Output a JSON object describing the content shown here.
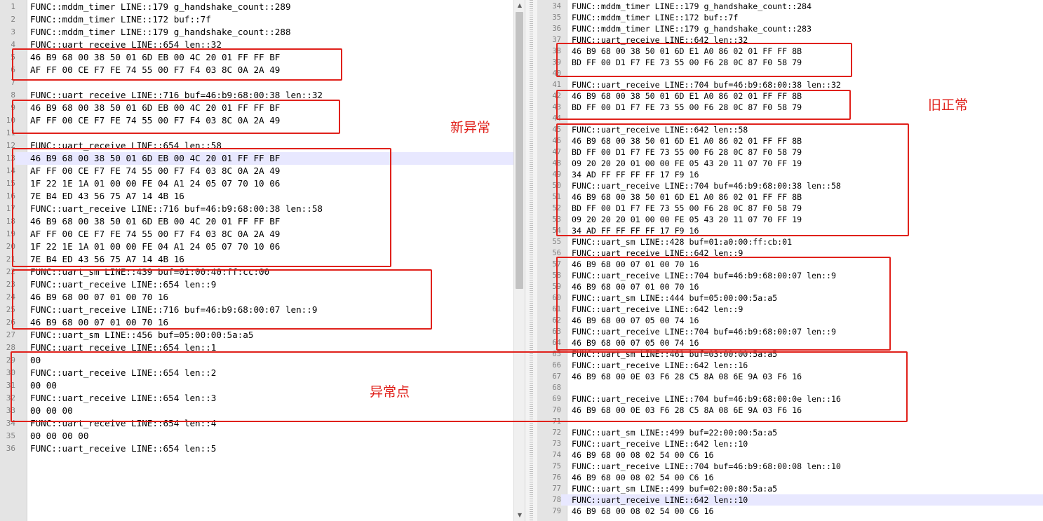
{
  "left_pane": {
    "lines": [
      {
        "n": "1",
        "text": "FUNC::mddm_timer LINE::179 g_handshake_count::289"
      },
      {
        "n": "2",
        "text": "FUNC::mddm_timer LINE::172 buf::7f"
      },
      {
        "n": "3",
        "text": "FUNC::mddm_timer LINE::179 g_handshake_count::288"
      },
      {
        "n": "4",
        "text": "FUNC::uart_receive LINE::654 len::32"
      },
      {
        "n": "5",
        "text": "46 B9 68 00 38 50 01 6D EB 00 4C 20 01 FF FF BF"
      },
      {
        "n": "6",
        "text": "AF FF 00 CE F7 FE 74 55 00 F7 F4 03 8C 0A 2A 49"
      },
      {
        "n": "7",
        "text": ""
      },
      {
        "n": "8",
        "text": "FUNC::uart_receive LINE::716 buf=46:b9:68:00:38 len::32"
      },
      {
        "n": "9",
        "text": "46 B9 68 00 38 50 01 6D EB 00 4C 20 01 FF FF BF"
      },
      {
        "n": "10",
        "text": "AF FF 00 CE F7 FE 74 55 00 F7 F4 03 8C 0A 2A 49"
      },
      {
        "n": "11",
        "text": ""
      },
      {
        "n": "12",
        "text": "FUNC::uart_receive LINE::654 len::58"
      },
      {
        "n": "13",
        "text": "46 B9 68 00 38 50 01 6D EB 00 4C 20 01 FF FF BF"
      },
      {
        "n": "14",
        "text": "AF FF 00 CE F7 FE 74 55 00 F7 F4 03 8C 0A 2A 49"
      },
      {
        "n": "15",
        "text": "1F 22 1E 1A 01 00 00 FE 04 A1 24 05 07 70 10 06"
      },
      {
        "n": "16",
        "text": "7E B4 ED 43 56 75 A7 14 4B 16"
      },
      {
        "n": "17",
        "text": "FUNC::uart_receive LINE::716 buf=46:b9:68:00:38 len::58"
      },
      {
        "n": "18",
        "text": "46 B9 68 00 38 50 01 6D EB 00 4C 20 01 FF FF BF"
      },
      {
        "n": "19",
        "text": "AF FF 00 CE F7 FE 74 55 00 F7 F4 03 8C 0A 2A 49"
      },
      {
        "n": "20",
        "text": "1F 22 1E 1A 01 00 00 FE 04 A1 24 05 07 70 10 06"
      },
      {
        "n": "21",
        "text": "7E B4 ED 43 56 75 A7 14 4B 16"
      },
      {
        "n": "22",
        "text": "FUNC::uart_sm LINE::439 buf=01:00:40:ff:cc:00"
      },
      {
        "n": "23",
        "text": "FUNC::uart_receive LINE::654 len::9"
      },
      {
        "n": "24",
        "text": "46 B9 68 00 07 01 00 70 16"
      },
      {
        "n": "25",
        "text": "FUNC::uart_receive LINE::716 buf=46:b9:68:00:07 len::9"
      },
      {
        "n": "26",
        "text": "46 B9 68 00 07 01 00 70 16"
      },
      {
        "n": "27",
        "text": "FUNC::uart_sm LINE::456 buf=05:00:00:5a:a5"
      },
      {
        "n": "28",
        "text": "FUNC::uart_receive LINE::654 len::1"
      },
      {
        "n": "29",
        "text": "00"
      },
      {
        "n": "30",
        "text": "FUNC::uart_receive LINE::654 len::2"
      },
      {
        "n": "31",
        "text": "00 00"
      },
      {
        "n": "32",
        "text": "FUNC::uart_receive LINE::654 len::3"
      },
      {
        "n": "33",
        "text": "00 00 00"
      },
      {
        "n": "34",
        "text": "FUNC::uart_receive LINE::654 len::4"
      },
      {
        "n": "35",
        "text": "00 00 00 00"
      },
      {
        "n": "36",
        "text": "FUNC::uart_receive LINE::654 len::5"
      }
    ]
  },
  "right_pane": {
    "lines": [
      {
        "n": "34",
        "text": "FUNC::mddm_timer LINE::179 g_handshake_count::284"
      },
      {
        "n": "35",
        "text": "FUNC::mddm_timer LINE::172 buf::7f"
      },
      {
        "n": "36",
        "text": "FUNC::mddm_timer LINE::179 g_handshake_count::283"
      },
      {
        "n": "37",
        "text": "FUNC::uart_receive LINE::642 len::32"
      },
      {
        "n": "38",
        "text": "46 B9 68 00 38 50 01 6D E1 A0 86 02 01 FF FF 8B"
      },
      {
        "n": "39",
        "text": "BD FF 00 D1 F7 FE 73 55 00 F6 28 0C 87 F0 58 79"
      },
      {
        "n": "40",
        "text": ""
      },
      {
        "n": "41",
        "text": "FUNC::uart_receive LINE::704 buf=46:b9:68:00:38 len::32"
      },
      {
        "n": "42",
        "text": "46 B9 68 00 38 50 01 6D E1 A0 86 02 01 FF FF 8B"
      },
      {
        "n": "43",
        "text": "BD FF 00 D1 F7 FE 73 55 00 F6 28 0C 87 F0 58 79"
      },
      {
        "n": "44",
        "text": ""
      },
      {
        "n": "45",
        "text": "FUNC::uart_receive LINE::642 len::58"
      },
      {
        "n": "46",
        "text": "46 B9 68 00 38 50 01 6D E1 A0 86 02 01 FF FF 8B"
      },
      {
        "n": "47",
        "text": "BD FF 00 D1 F7 FE 73 55 00 F6 28 0C 87 F0 58 79"
      },
      {
        "n": "48",
        "text": "09 20 20 20 01 00 00 FE 05 43 20 11 07 70 FF 19"
      },
      {
        "n": "49",
        "text": "34 AD FF FF FF FF 17 F9 16"
      },
      {
        "n": "50",
        "text": "FUNC::uart_receive LINE::704 buf=46:b9:68:00:38 len::58"
      },
      {
        "n": "51",
        "text": "46 B9 68 00 38 50 01 6D E1 A0 86 02 01 FF FF 8B"
      },
      {
        "n": "52",
        "text": "BD FF 00 D1 F7 FE 73 55 00 F6 28 0C 87 F0 58 79"
      },
      {
        "n": "53",
        "text": "09 20 20 20 01 00 00 FE 05 43 20 11 07 70 FF 19"
      },
      {
        "n": "54",
        "text": "34 AD FF FF FF FF 17 F9 16"
      },
      {
        "n": "55",
        "text": "FUNC::uart_sm LINE::428 buf=01:a0:00:ff:cb:01"
      },
      {
        "n": "56",
        "text": "FUNC::uart_receive LINE::642 len::9"
      },
      {
        "n": "57",
        "text": "46 B9 68 00 07 01 00 70 16"
      },
      {
        "n": "58",
        "text": "FUNC::uart_receive LINE::704 buf=46:b9:68:00:07 len::9"
      },
      {
        "n": "59",
        "text": "46 B9 68 00 07 01 00 70 16"
      },
      {
        "n": "60",
        "text": "FUNC::uart_sm LINE::444 buf=05:00:00:5a:a5"
      },
      {
        "n": "61",
        "text": "FUNC::uart_receive LINE::642 len::9"
      },
      {
        "n": "62",
        "text": "46 B9 68 00 07 05 00 74 16"
      },
      {
        "n": "63",
        "text": "FUNC::uart_receive LINE::704 buf=46:b9:68:00:07 len::9"
      },
      {
        "n": "64",
        "text": "46 B9 68 00 07 05 00 74 16"
      },
      {
        "n": "65",
        "text": "FUNC::uart_sm LINE::461 buf=03:00:00:5a:a5"
      },
      {
        "n": "66",
        "text": "FUNC::uart_receive LINE::642 len::16"
      },
      {
        "n": "67",
        "text": "46 B9 68 00 0E 03 F6 28 C5 8A 08 6E 9A 03 F6 16"
      },
      {
        "n": "68",
        "text": ""
      },
      {
        "n": "69",
        "text": "FUNC::uart_receive LINE::704 buf=46:b9:68:00:0e len::16"
      },
      {
        "n": "70",
        "text": "46 B9 68 00 0E 03 F6 28 C5 8A 08 6E 9A 03 F6 16"
      },
      {
        "n": "71",
        "text": ""
      },
      {
        "n": "72",
        "text": "FUNC::uart_sm LINE::499 buf=22:00:00:5a:a5"
      },
      {
        "n": "73",
        "text": "FUNC::uart_receive LINE::642 len::10"
      },
      {
        "n": "74",
        "text": "46 B9 68 00 08 02 54 00 C6 16"
      },
      {
        "n": "75",
        "text": "FUNC::uart_receive LINE::704 buf=46:b9:68:00:08 len::10"
      },
      {
        "n": "76",
        "text": "46 B9 68 00 08 02 54 00 C6 16"
      },
      {
        "n": "77",
        "text": "FUNC::uart_sm LINE::499 buf=02:00:80:5a:a5"
      },
      {
        "n": "78",
        "text": "FUNC::uart_receive LINE::642 len::10"
      },
      {
        "n": "79",
        "text": "46 B9 68 00 08 02 54 00 C6 16"
      }
    ]
  },
  "annotations": {
    "new_abnormal": "新异常",
    "old_normal": "旧正常",
    "abnormal_point": "异常点"
  },
  "colors": {
    "annotation_red": "#e0211b",
    "gutter_bg": "#e4e4e4",
    "current_line_bg": "#e8e8ff"
  }
}
